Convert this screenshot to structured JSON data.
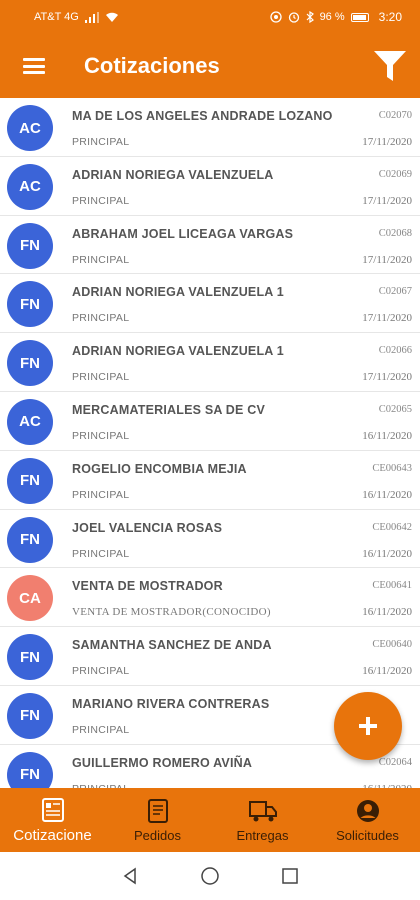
{
  "status_bar": {
    "carrier": "AT&T 4G",
    "battery": "96 %",
    "time": "3:20"
  },
  "app_bar": {
    "title": "Cotizaciones"
  },
  "colors": {
    "primary": "#e8740c",
    "avatar_blue": "#3b64d8",
    "avatar_salmon": "#f17f6f"
  },
  "quotes": [
    {
      "initials": "AC",
      "avatar_color": "#3b64d8",
      "name": "MA DE LOS ANGELES ANDRADE LOZANO",
      "branch": "PRINCIPAL",
      "code": "C02070",
      "date": "17/11/2020"
    },
    {
      "initials": "AC",
      "avatar_color": "#3b64d8",
      "name": "ADRIAN NORIEGA VALENZUELA",
      "branch": "PRINCIPAL",
      "code": "C02069",
      "date": "17/11/2020"
    },
    {
      "initials": "FN",
      "avatar_color": "#3b64d8",
      "name": "ABRAHAM  JOEL LICEAGA VARGAS",
      "branch": "PRINCIPAL",
      "code": "C02068",
      "date": "17/11/2020"
    },
    {
      "initials": "FN",
      "avatar_color": "#3b64d8",
      "name": "ADRIAN NORIEGA VALENZUELA 1",
      "branch": "PRINCIPAL",
      "code": "C02067",
      "date": "17/11/2020"
    },
    {
      "initials": "FN",
      "avatar_color": "#3b64d8",
      "name": "ADRIAN NORIEGA VALENZUELA 1",
      "branch": "PRINCIPAL",
      "code": "C02066",
      "date": "17/11/2020"
    },
    {
      "initials": "AC",
      "avatar_color": "#3b64d8",
      "name": "MERCAMATERIALES SA DE CV",
      "branch": "PRINCIPAL",
      "code": "C02065",
      "date": "16/11/2020"
    },
    {
      "initials": "FN",
      "avatar_color": "#3b64d8",
      "name": "ROGELIO ENCOMBIA MEJIA",
      "branch": "PRINCIPAL",
      "code": "CE00643",
      "date": "16/11/2020"
    },
    {
      "initials": "FN",
      "avatar_color": "#3b64d8",
      "name": "JOEL VALENCIA ROSAS",
      "branch": "PRINCIPAL",
      "code": "CE00642",
      "date": "16/11/2020"
    },
    {
      "initials": "CA",
      "avatar_color": "#f17f6f",
      "name": "VENTA DE MOSTRADOR",
      "branch": "VENTA DE MOSTRADOR(CONOCIDO)",
      "code": "CE00641",
      "date": "16/11/2020"
    },
    {
      "initials": "FN",
      "avatar_color": "#3b64d8",
      "name": "SAMANTHA SANCHEZ DE ANDA",
      "branch": "PRINCIPAL",
      "code": "CE00640",
      "date": "16/11/2020"
    },
    {
      "initials": "FN",
      "avatar_color": "#3b64d8",
      "name": "MARIANO RIVERA CONTRERAS",
      "branch": "PRINCIPAL",
      "code": "",
      "date": ""
    },
    {
      "initials": "FN",
      "avatar_color": "#3b64d8",
      "name": "GUILLERMO ROMERO AVIÑA",
      "branch": "PRINCIPAL",
      "code": "C02064",
      "date": "16/11/2020"
    }
  ],
  "bottom_nav": [
    {
      "label": "Cotizacione",
      "icon": "quote-icon",
      "active": true
    },
    {
      "label": "Pedidos",
      "icon": "orders-icon",
      "active": false
    },
    {
      "label": "Entregas",
      "icon": "truck-icon",
      "active": false
    },
    {
      "label": "Solicitudes",
      "icon": "account-icon",
      "active": false
    }
  ]
}
